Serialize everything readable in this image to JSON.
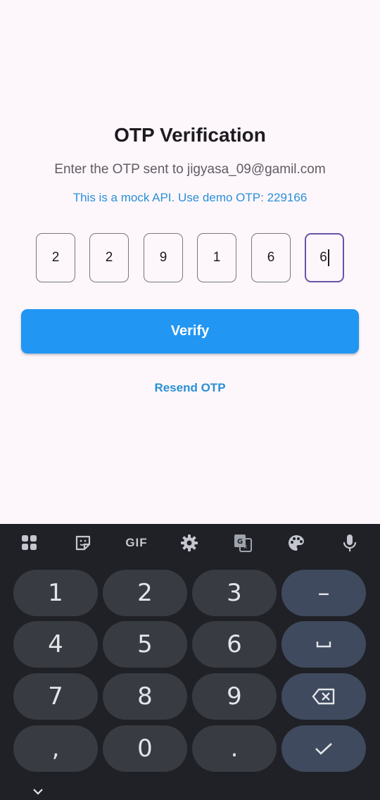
{
  "page": {
    "title": "OTP Verification",
    "subtitle": "Enter the OTP sent to jigyasa_09@gamil.com",
    "mock_note": "This is a mock API. Use demo OTP: 229166",
    "otp_digits": [
      "2",
      "2",
      "9",
      "1",
      "6",
      "6"
    ],
    "verify_label": "Verify",
    "resend_label": "Resend OTP"
  },
  "keyboard": {
    "toolbar_icons": [
      "apps-grid-icon",
      "sticker-icon",
      "gif-icon",
      "settings-icon",
      "translate-icon",
      "palette-icon",
      "mic-icon"
    ],
    "gif_label": "GIF",
    "keys": {
      "k1": "1",
      "k2": "2",
      "k3": "3",
      "k4": "4",
      "k5": "5",
      "k6": "6",
      "k7": "7",
      "k8": "8",
      "k9": "9",
      "comma": ",",
      "k0": "0",
      "period": ".",
      "dash": "–"
    }
  },
  "colors": {
    "accent": "#2196f3",
    "link": "#2a8fd6",
    "focus_border": "#6a53a5",
    "keyboard_bg": "#1f2126"
  }
}
